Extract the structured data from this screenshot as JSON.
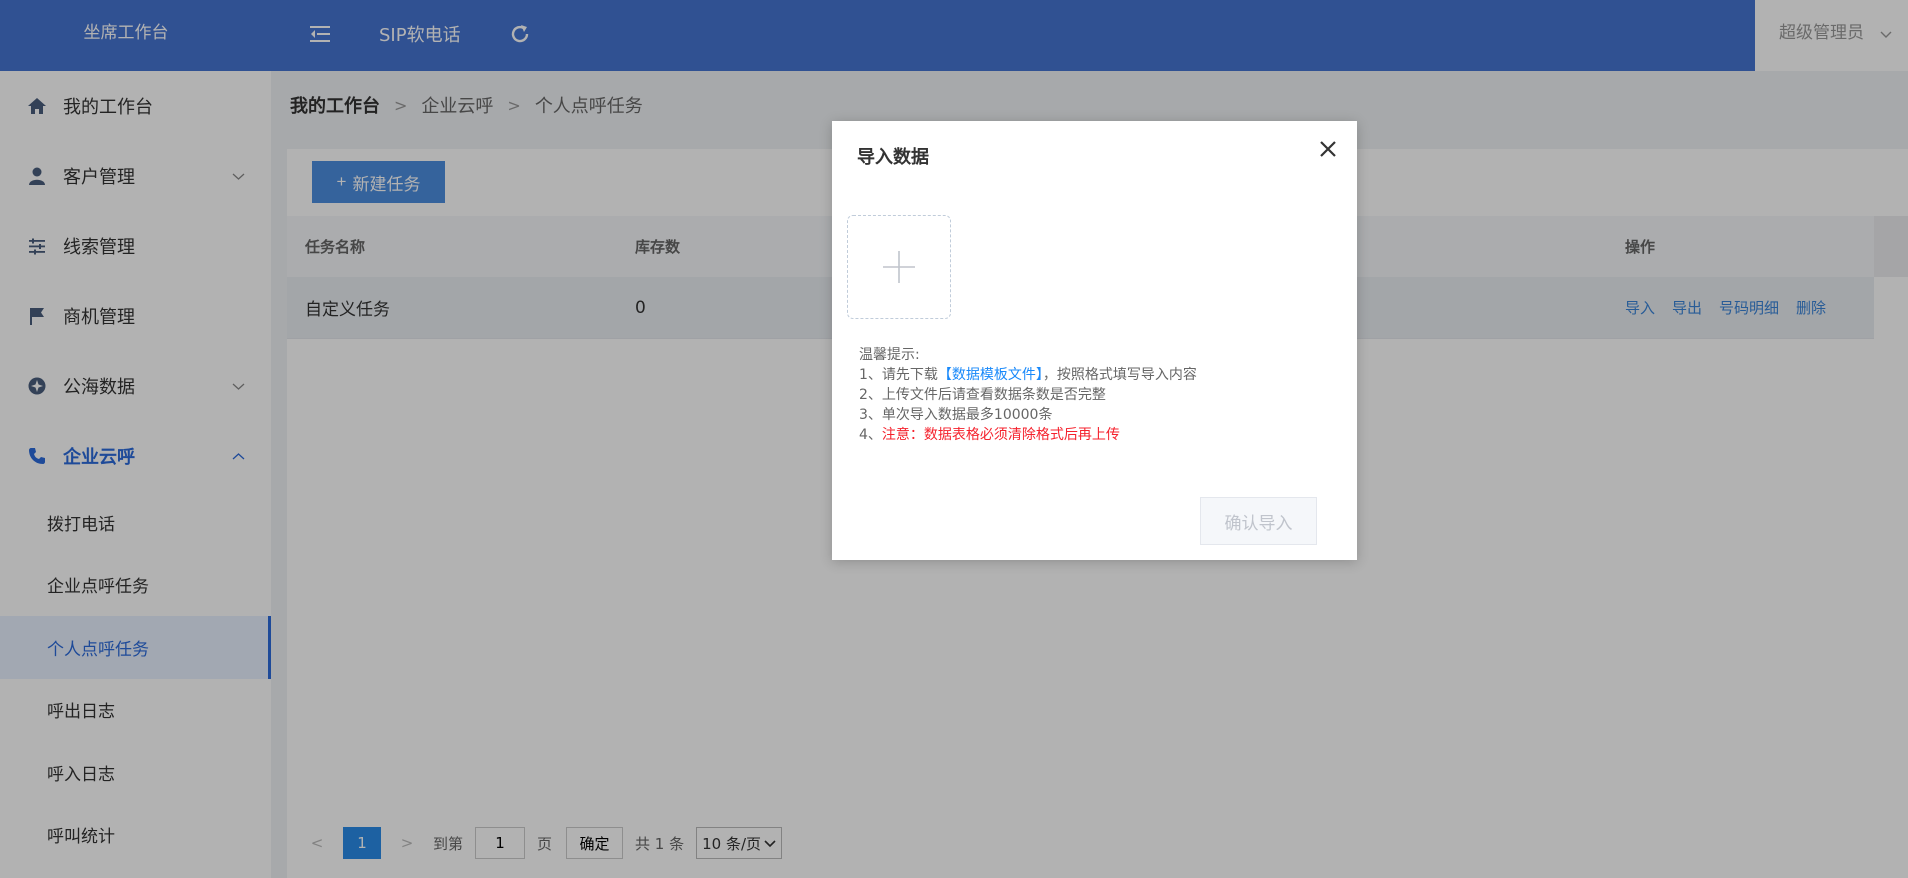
{
  "header": {
    "brand": "坐席工作台",
    "sip_label": "SIP软电话",
    "user_name": "超级管理员"
  },
  "sidebar": {
    "items": [
      {
        "label": "我的工作台",
        "icon": "home-icon"
      },
      {
        "label": "客户管理",
        "icon": "user-icon"
      },
      {
        "label": "线索管理",
        "icon": "sliders-icon"
      },
      {
        "label": "商机管理",
        "icon": "flag-icon"
      },
      {
        "label": "公海数据",
        "icon": "compass-icon"
      },
      {
        "label": "企业云呼",
        "icon": "phone-icon"
      }
    ],
    "sub_items": [
      "拨打电话",
      "企业点呼任务",
      "个人点呼任务",
      "呼出日志",
      "呼入日志",
      "呼叫统计"
    ]
  },
  "breadcrumb": [
    "我的工作台",
    "企业云呼",
    "个人点呼任务"
  ],
  "toolbar": {
    "new_task_label": "新建任务"
  },
  "table": {
    "columns": [
      "任务名称",
      "库存数",
      "操作"
    ],
    "rows": [
      {
        "name": "自定义任务",
        "stock": "0",
        "actions": [
          "导入",
          "导出",
          "号码明细",
          "删除"
        ]
      }
    ]
  },
  "pagination": {
    "current_page": "1",
    "goto_label": "到第",
    "page_input_value": "1",
    "page_unit": "页",
    "confirm_label": "确定",
    "total_label": "共 1 条",
    "page_size": "10 条/页"
  },
  "dialog": {
    "title": "导入数据",
    "tips": {
      "heading": "温馨提示:",
      "line1_prefix": "1、请先下载",
      "line1_link": "【数据模板文件】",
      "line1_suffix": "，按照格式填写导入内容",
      "line2": "2、上传文件后请查看数据条数是否完整",
      "line3": "3、单次导入数据最多10000条",
      "line4_prefix": "4、",
      "line4_warn": "注意：数据表格必须清除格式后再上传"
    },
    "confirm_label": "确认导入"
  },
  "colors": {
    "header_bg": "#4674d2",
    "accent": "#2b6bdb",
    "link": "#1989fa",
    "warning": "#f5222d"
  }
}
